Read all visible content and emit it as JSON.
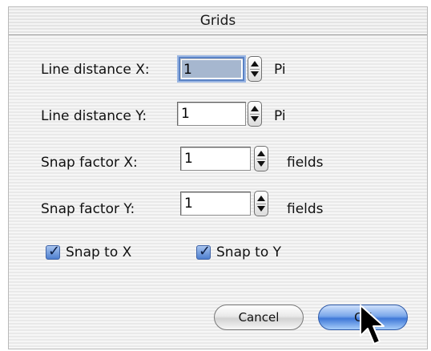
{
  "window": {
    "title": "Grids"
  },
  "fields": [
    {
      "label": "Line distance X:",
      "value": "1",
      "unit": "Pi",
      "focused": true
    },
    {
      "label": "Line distance Y:",
      "value": "1",
      "unit": "Pi",
      "focused": false
    },
    {
      "label": "Snap factor X:",
      "value": "1",
      "unit": "fields",
      "focused": false
    },
    {
      "label": "Snap factor Y:",
      "value": "1",
      "unit": "fields",
      "focused": false
    }
  ],
  "checkboxes": [
    {
      "label": "Snap to X",
      "checked": true
    },
    {
      "label": "Snap to Y",
      "checked": true
    }
  ],
  "buttons": {
    "cancel_label": "Cancel",
    "ok_label": "OK"
  },
  "colors": {
    "focus_ring": "#5a82c4",
    "default_button": "#3f78d8",
    "checkbox_fill": "#4e7fd0"
  },
  "icons": {
    "stepper": "stepper-arrows-icon",
    "checkmark": "checkmark-icon",
    "cursor": "arrow-pointer-icon"
  }
}
